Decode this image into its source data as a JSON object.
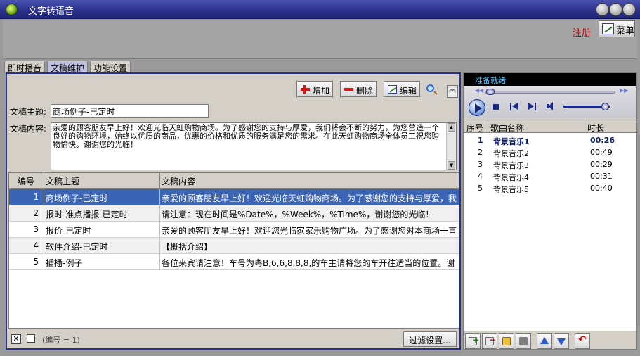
{
  "window": {
    "title": "文字转语音"
  },
  "top": {
    "register": "注册",
    "menu": "菜单"
  },
  "tabs": [
    {
      "label": "即时播音"
    },
    {
      "label": "文稿维护"
    },
    {
      "label": "功能设置"
    }
  ],
  "toolbar": {
    "add": "增加",
    "delete": "删除",
    "edit": "编辑",
    "collapse": "︽"
  },
  "form": {
    "subject_label": "文稿主题:",
    "subject_value": "商场例子-已定时",
    "content_label": "文稿内容:",
    "content_value": "亲爱的顾客朋友早上好！欢迎光临天虹购物商场。为了感谢您的支持与厚爱，我们将会不断的努力，为您营造一个良好的购物环境，始终以优质的商品，优惠的价格和优质的服务满足您的需求。在此天虹购物商场全体员工祝您购物愉快。谢谢您的光临！"
  },
  "grid": {
    "columns": [
      "编号",
      "文稿主题",
      "文稿内容"
    ],
    "rows": [
      {
        "id": "1",
        "subject": "商场例子-已定时",
        "content": "亲爱的顾客朋友早上好！欢迎光临天虹购物商场。为了感谢您的支持与厚爱，我"
      },
      {
        "id": "2",
        "subject": "报时-准点播报-已定时",
        "content": "请注意：现在时间是%Date%，%Week%，%Time%，谢谢您的光临！"
      },
      {
        "id": "3",
        "subject": "报价-已定时",
        "content": "亲爱的顾客朋友早上好！欢迎您光临家家乐购物广场。为了感谢您对本商场一直"
      },
      {
        "id": "4",
        "subject": "软件介绍-已定时",
        "content": "【概括介绍】"
      },
      {
        "id": "5",
        "subject": "插播-例子",
        "content": "各位来宾请注意！车号为粤B,6,6,8,8,8,的车主请将您的车开往适当的位置。谢"
      }
    ]
  },
  "filter": {
    "x_mark": "✕",
    "status": "(编号 = 1)",
    "settings_button": "过滤设置..."
  },
  "player": {
    "status": "准备就绪",
    "columns": [
      "序号",
      "歌曲名称",
      "时长"
    ],
    "tracks": [
      {
        "no": "1",
        "name": "背景音乐1",
        "duration": "00:26",
        "playing": true
      },
      {
        "no": "2",
        "name": "背景音乐2",
        "duration": "00:49"
      },
      {
        "no": "3",
        "name": "背景音乐3",
        "duration": "00:29"
      },
      {
        "no": "4",
        "name": "背景音乐4",
        "duration": "00:31"
      },
      {
        "no": "5",
        "name": "背景音乐5",
        "duration": "00:40"
      }
    ]
  },
  "colors": {
    "title_bar": "#2a2f8a",
    "selection": "#3c64b4",
    "accent_red": "#c00000"
  }
}
